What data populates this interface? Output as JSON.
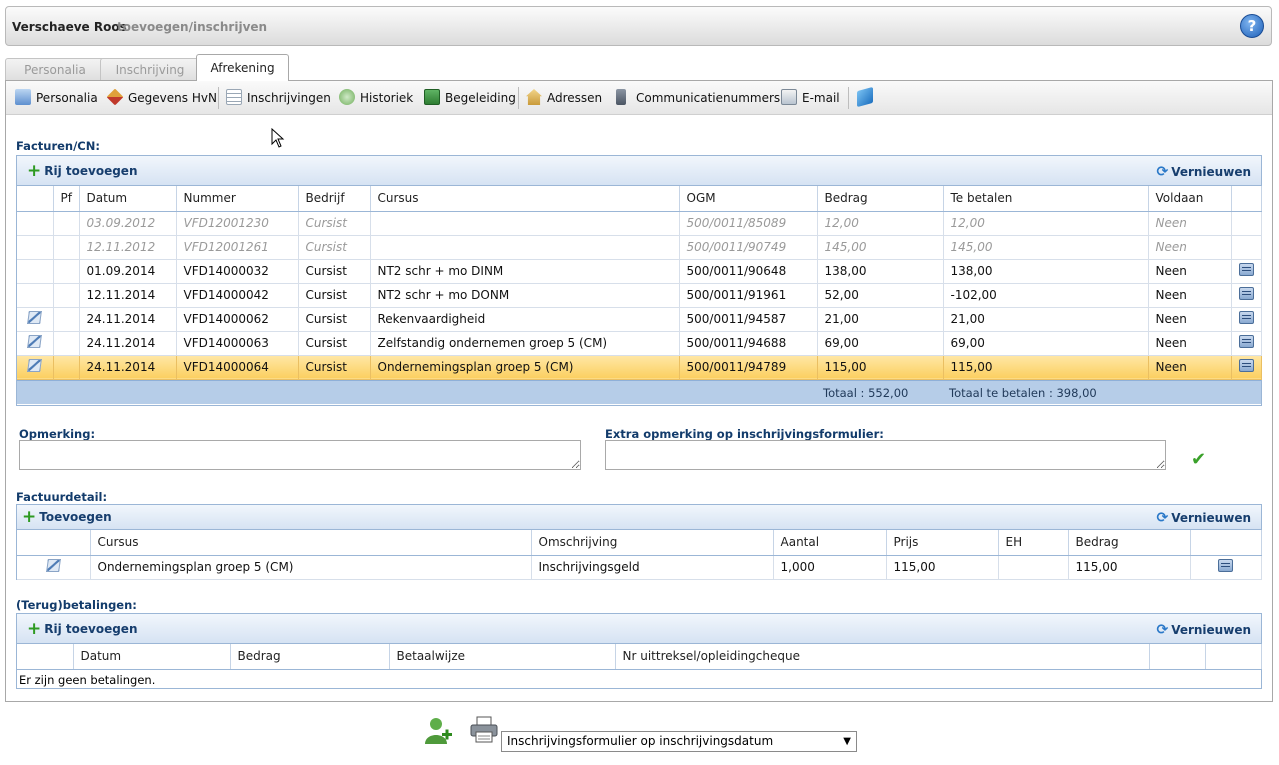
{
  "header": {
    "name": "Verschaeve Roos",
    "subtitle": "toevoegen/inschrijven",
    "help_icon": "?"
  },
  "tabs": [
    {
      "label": "Personalia",
      "active": false
    },
    {
      "label": "Inschrijving",
      "active": false
    },
    {
      "label": "Afrekening",
      "active": true
    }
  ],
  "toolbar": {
    "items": [
      {
        "label": "Personalia",
        "icon": "person-card-icon"
      },
      {
        "label": "Gegevens HvN",
        "icon": "diamond-icon"
      },
      {
        "label": "Inschrijvingen",
        "icon": "list-icon"
      },
      {
        "label": "Historiek",
        "icon": "history-icon"
      },
      {
        "label": "Begeleiding",
        "icon": "book-green-icon"
      },
      {
        "label": "Adressen",
        "icon": "house-icon"
      },
      {
        "label": "Communicatienummers",
        "icon": "phone-icon"
      },
      {
        "label": "E-mail",
        "icon": "email-icon"
      },
      {
        "label": "",
        "icon": "blue-book-icon"
      }
    ]
  },
  "invoices": {
    "label": "Facturen/CN:",
    "add_label": "Rij toevoegen",
    "refresh_label": "Vernieuwen",
    "columns": [
      "",
      "Pf",
      "Datum",
      "Nummer",
      "Bedrijf",
      "Cursus",
      "OGM",
      "Bedrag",
      "Te betalen",
      "Voldaan",
      ""
    ],
    "rows": [
      {
        "edit": false,
        "datum": "03.09.2012",
        "nummer": "VFD12001230",
        "bedrijf": "Cursist",
        "cursus": "",
        "ogm": "500/0011/85089",
        "bedrag": "12,00",
        "te_betalen": "12,00",
        "voldaan": "Neen",
        "doc": false,
        "dim": true,
        "selected": false
      },
      {
        "edit": false,
        "datum": "12.11.2012",
        "nummer": "VFD12001261",
        "bedrijf": "Cursist",
        "cursus": "",
        "ogm": "500/0011/90749",
        "bedrag": "145,00",
        "te_betalen": "145,00",
        "voldaan": "Neen",
        "doc": false,
        "dim": true,
        "selected": false
      },
      {
        "edit": false,
        "datum": "01.09.2014",
        "nummer": "VFD14000032",
        "bedrijf": "Cursist",
        "cursus": "NT2 schr + mo DINM",
        "ogm": "500/0011/90648",
        "bedrag": "138,00",
        "te_betalen": "138,00",
        "voldaan": "Neen",
        "doc": true,
        "dim": false,
        "selected": false
      },
      {
        "edit": false,
        "datum": "12.11.2014",
        "nummer": "VFD14000042",
        "bedrijf": "Cursist",
        "cursus": "NT2 schr + mo DONM",
        "ogm": "500/0011/91961",
        "bedrag": "52,00",
        "te_betalen": "-102,00",
        "voldaan": "Neen",
        "doc": true,
        "dim": false,
        "selected": false
      },
      {
        "edit": true,
        "datum": "24.11.2014",
        "nummer": "VFD14000062",
        "bedrijf": "Cursist",
        "cursus": "Rekenvaardigheid",
        "ogm": "500/0011/94587",
        "bedrag": "21,00",
        "te_betalen": "21,00",
        "voldaan": "Neen",
        "doc": true,
        "dim": false,
        "selected": false
      },
      {
        "edit": true,
        "datum": "24.11.2014",
        "nummer": "VFD14000063",
        "bedrijf": "Cursist",
        "cursus": "Zelfstandig ondernemen groep 5 (CM)",
        "ogm": "500/0011/94688",
        "bedrag": "69,00",
        "te_betalen": "69,00",
        "voldaan": "Neen",
        "doc": true,
        "dim": false,
        "selected": false
      },
      {
        "edit": true,
        "datum": "24.11.2014",
        "nummer": "VFD14000064",
        "bedrijf": "Cursist",
        "cursus": "Ondernemingsplan groep 5 (CM)",
        "ogm": "500/0011/94789",
        "bedrag": "115,00",
        "te_betalen": "115,00",
        "voldaan": "Neen",
        "doc": true,
        "dim": false,
        "selected": true
      }
    ],
    "totaal": "Totaal : 552,00",
    "totaal_te_betalen": "Totaal te betalen : 398,00"
  },
  "remarks": {
    "opmerking_label": "Opmerking:",
    "extra_label": "Extra opmerking op inschrijvingsformulier:",
    "opmerking_value": "",
    "extra_value": ""
  },
  "detail": {
    "label": "Factuurdetail:",
    "add_label": "Toevoegen",
    "refresh_label": "Vernieuwen",
    "columns": [
      "",
      "Cursus",
      "Omschrijving",
      "Aantal",
      "Prijs",
      "EH",
      "Bedrag",
      ""
    ],
    "rows": [
      {
        "cursus": "Ondernemingsplan groep 5 (CM)",
        "omschrijving": "Inschrijvingsgeld",
        "aantal": "1,000",
        "prijs": "115,00",
        "eh": "",
        "bedrag": "115,00"
      }
    ]
  },
  "payments": {
    "label": "(Terug)betalingen:",
    "add_label": "Rij toevoegen",
    "refresh_label": "Vernieuwen",
    "columns": [
      "",
      "Datum",
      "Bedrag",
      "Betaalwijze",
      "Nr uittreksel/opleidingcheque",
      "",
      ""
    ],
    "empty_text": "Er zijn geen betalingen."
  },
  "bottom": {
    "select_value": "Inschrijvingsformulier op inschrijvingsdatum"
  }
}
